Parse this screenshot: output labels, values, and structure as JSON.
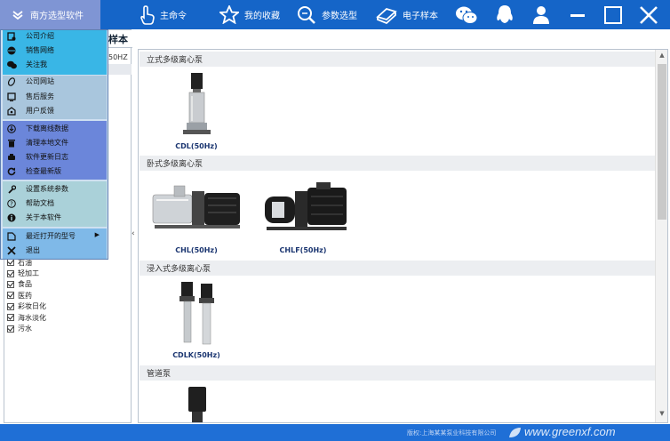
{
  "app": {
    "title": "南方选型软件"
  },
  "toolbar": {
    "main_menu": "主命令",
    "favorites": "我的收藏",
    "param_select": "参数选型",
    "e_catalog": "电子样本"
  },
  "menu": {
    "items": [
      {
        "label": "公司介绍",
        "icon": "company-intro-icon"
      },
      {
        "label": "销售网络",
        "icon": "sales-network-icon"
      },
      {
        "label": "关注我",
        "icon": "wechat-icon"
      },
      {
        "label": "公司网站",
        "icon": "website-icon"
      },
      {
        "label": "售后服务",
        "icon": "after-sales-icon"
      },
      {
        "label": "用户反馈",
        "icon": "feedback-icon"
      },
      {
        "label": "下载离线数据",
        "icon": "download-icon"
      },
      {
        "label": "清理本地文件",
        "icon": "clean-icon"
      },
      {
        "label": "软件更新日志",
        "icon": "update-log-icon"
      },
      {
        "label": "检查最新版",
        "icon": "refresh-icon"
      },
      {
        "label": "设置系统参数",
        "icon": "settings-icon"
      },
      {
        "label": "帮助文档",
        "icon": "help-icon"
      },
      {
        "label": "关于本软件",
        "icon": "info-icon"
      },
      {
        "label": "最近打开的型号",
        "icon": "recent-icon"
      },
      {
        "label": "退出",
        "icon": "exit-icon"
      }
    ]
  },
  "left": {
    "tab_label": "样本",
    "sub_label": "50HZ",
    "collapse_glyph": "‹",
    "checkboxes": [
      "石油",
      "轻加工",
      "食品",
      "医药",
      "彩妆日化",
      "海水淡化",
      "污水"
    ]
  },
  "main": {
    "sections": [
      {
        "title": "立式多级离心泵",
        "products": [
          "CDL(50Hz)"
        ]
      },
      {
        "title": "卧式多级离心泵",
        "products": [
          "CHL(50Hz)",
          "CHLF(50Hz)"
        ]
      },
      {
        "title": "浸入式多级离心泵",
        "products": [
          "CDLK(50Hz)"
        ]
      },
      {
        "title": "管道泵",
        "products": []
      }
    ]
  },
  "status": {
    "text": "版权:上海某某泵业科技有限公司",
    "watermark": "www.greenxf.com"
  },
  "colors": {
    "topbar": "#1565c8",
    "app_button": "#7f95d4",
    "statusbar": "#1f6fd6"
  }
}
